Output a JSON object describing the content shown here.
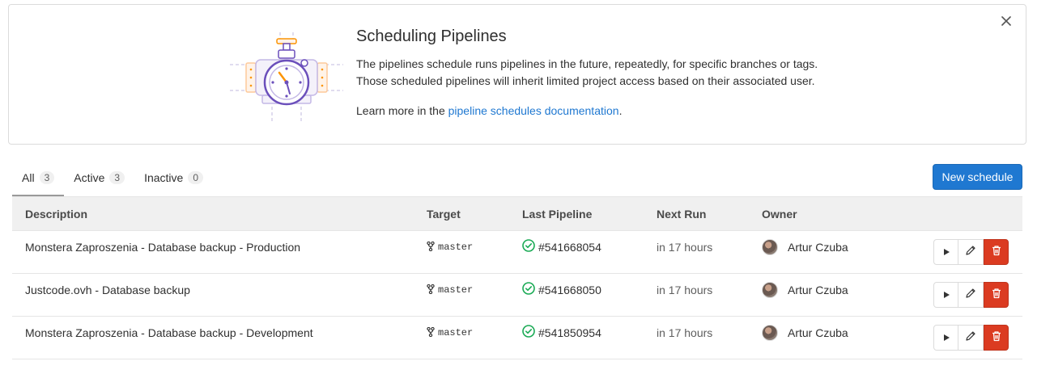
{
  "banner": {
    "title": "Scheduling Pipelines",
    "line1": "The pipelines schedule runs pipelines in the future, repeatedly, for specific branches or tags.",
    "line2": "Those scheduled pipelines will inherit limited project access based on their associated user.",
    "learn_prefix": "Learn more in the ",
    "learn_link": "pipeline schedules documentation",
    "learn_suffix": ".",
    "close_icon": "close-icon",
    "illustration_icon": "pipeline-schedule-stopwatch-icon"
  },
  "tabs": [
    {
      "label": "All",
      "count": "3"
    },
    {
      "label": "Active",
      "count": "3"
    },
    {
      "label": "Inactive",
      "count": "0"
    }
  ],
  "new_schedule_label": "New schedule",
  "table": {
    "headers": [
      "Description",
      "Target",
      "Last Pipeline",
      "Next Run",
      "Owner"
    ],
    "rows": [
      {
        "description": "Monstera Zaproszenia - Database backup - Production",
        "target": "master",
        "pipeline": "#541668054",
        "next_run": "in 17 hours",
        "owner": "Artur Czuba"
      },
      {
        "description": "Justcode.ovh - Database backup",
        "target": "master",
        "pipeline": "#541668050",
        "next_run": "in 17 hours",
        "owner": "Artur Czuba"
      },
      {
        "description": "Monstera Zaproszenia - Database backup - Development",
        "target": "master",
        "pipeline": "#541850954",
        "next_run": "in 17 hours",
        "owner": "Artur Czuba"
      }
    ]
  },
  "colors": {
    "primary": "#1f78d1",
    "danger": "#db3b21",
    "success": "#1aaa55",
    "illustration_purple": "#6b4fbb",
    "illustration_orange": "#fc9403"
  }
}
